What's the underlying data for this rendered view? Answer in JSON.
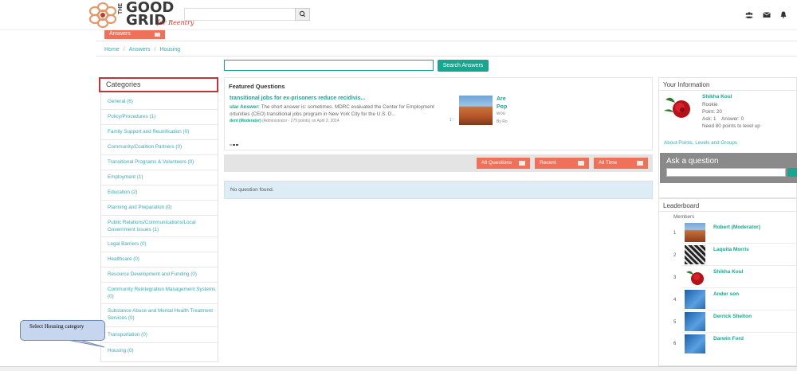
{
  "header": {
    "logo": {
      "line1": "THE",
      "line2": "GOOD",
      "line3": "GRID",
      "tagline": "for Reentry"
    },
    "search": {
      "placeholder": ""
    },
    "icons": [
      "users-icon",
      "mail-icon",
      "bell-icon"
    ]
  },
  "nav": {
    "active_tab": "Answers"
  },
  "breadcrumb": [
    "Home",
    "Answers",
    "Housing"
  ],
  "search": {
    "placeholder": "",
    "button": "Search Answers"
  },
  "categories": {
    "title": "Categories",
    "items": [
      "General (6)",
      "Policy/Procedures (1)",
      "Family Support and Reunification (0)",
      "Community/Coalition Partners (0)",
      "Transitional Programs & Volunteers (0)",
      "Employment (1)",
      "Education (2)",
      "Planning and Preparation (0)",
      "Public Relations/Communications/Local Government Issues (1)",
      "Legal Barriers (0)",
      "Healthcare (0)",
      "Resource Development and Funding (0)",
      "Community Reintegration Management Systems (0)",
      "Substance Abuse and Mental Health Treatment Services (0)",
      "Transportation (0)",
      "Housing (0)"
    ]
  },
  "featured": {
    "title": "Featured Questions",
    "question": "transitional jobs for ex-prisoners reduce recidivis...",
    "answer_label": "ular Answer:",
    "answer_text": "The short answer is: sometimes. MDRC evaluated the Center for Employment ortunities (CEO) transitional jobs program in New York City for the U.S. D...",
    "meta_author": "dent (Moderator)",
    "meta_rest": "(Administrator - 279 points) on April 2, 2014",
    "small_count": "1",
    "question2_line1": "Are",
    "question2_line2": "Pop",
    "question2_sub": "wou",
    "question2_by": "By Ro"
  },
  "filters": [
    "All Questions",
    "Recent",
    "All Time"
  ],
  "results": {
    "empty_text": "No question found."
  },
  "user_info": {
    "title": "Your Information",
    "name": "Shikha Koul",
    "rank": "Rookie",
    "points": "Point: 20",
    "stats": "Ask: 1    Answer: 0",
    "next_level": "Need 80 points to level up",
    "link": "About Points, Levels and Groups"
  },
  "ask": {
    "title": "Ask a question",
    "placeholder": ""
  },
  "leaderboard": {
    "title": "Leaderboard",
    "members_label": "Members",
    "rows": [
      {
        "rank": "1",
        "name": "Robert (Moderator)"
      },
      {
        "rank": "2",
        "name": "Laquita Morris"
      },
      {
        "rank": "3",
        "name": "Shikha Koul"
      },
      {
        "rank": "4",
        "name": "Ander son"
      },
      {
        "rank": "5",
        "name": "Derrick Shelton"
      },
      {
        "rank": "6",
        "name": "Darwin Ford"
      }
    ]
  },
  "callout": {
    "text": "Select Housing category"
  },
  "colors": {
    "accent_teal": "#1aa591",
    "accent_salmon": "#f0715a",
    "highlight_red": "#c0343b"
  }
}
